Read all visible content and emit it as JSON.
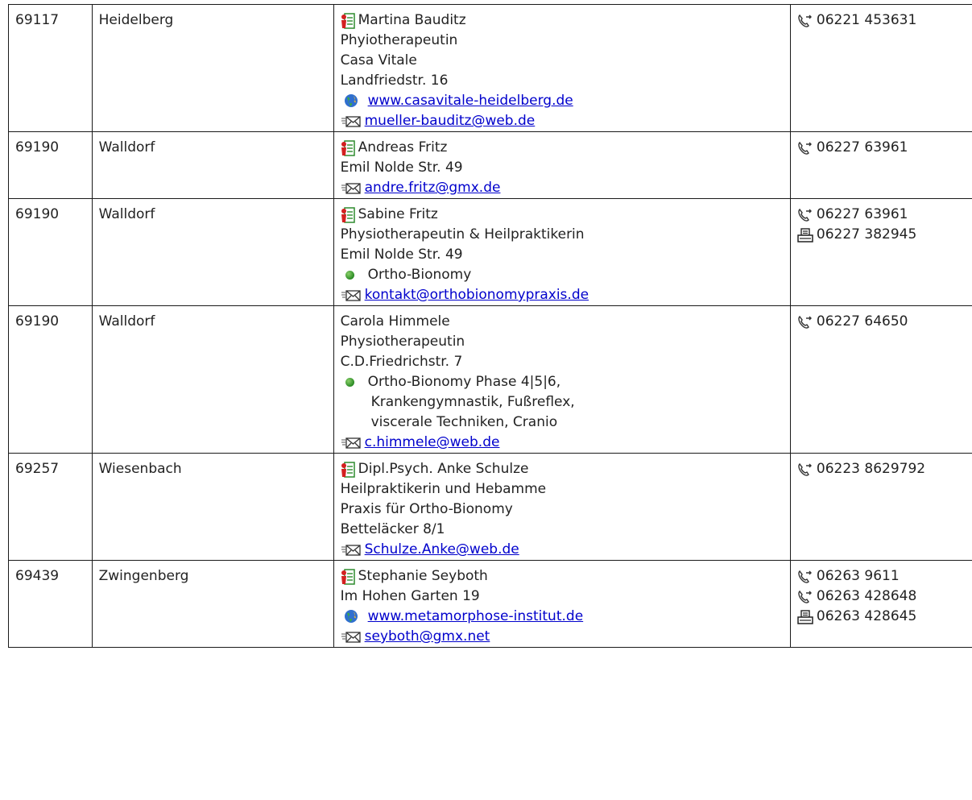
{
  "rows": [
    {
      "plz": "69117",
      "city": "Heidelberg",
      "name": "Martina Bauditz",
      "has_card": true,
      "lines": [
        "Phyiotherapeutin",
        "Casa Vitale",
        "Landfriedstr. 16"
      ],
      "web": "www.casavitale-heidelberg.de",
      "email": "mueller-bauditz@web.de",
      "phones": [
        {
          "type": "phone",
          "number": "06221 453631"
        }
      ]
    },
    {
      "plz": "69190",
      "city": "Walldorf",
      "name": "Andreas Fritz",
      "has_card": true,
      "lines": [
        "Emil Nolde Str. 49"
      ],
      "email": "andre.fritz@gmx.de",
      "phones": [
        {
          "type": "phone",
          "number": "06227 63961"
        }
      ]
    },
    {
      "plz": "69190",
      "city": "Walldorf",
      "name": "Sabine Fritz",
      "has_card": true,
      "lines": [
        "Physiotherapeutin & Heilpraktikerin",
        "Emil Nolde Str. 49"
      ],
      "bullet": [
        "Ortho-Bionomy"
      ],
      "email": "kontakt@orthobionomypraxis.de",
      "phones": [
        {
          "type": "phone",
          "number": "06227 63961"
        },
        {
          "type": "fax",
          "number": "06227 382945"
        }
      ]
    },
    {
      "plz": "69190",
      "city": "Walldorf",
      "name": "Carola Himmele",
      "has_card": false,
      "lines": [
        "Physiotherapeutin",
        "C.D.Friedrichstr. 7"
      ],
      "bullet": [
        "Ortho-Bionomy Phase 4|5|6,",
        "Krankengymnastik, Fußreflex,",
        "viscerale Techniken, Cranio"
      ],
      "email": "c.himmele@web.de",
      "phones": [
        {
          "type": "phone",
          "number": "06227 64650"
        }
      ]
    },
    {
      "plz": "69257",
      "city": "Wiesenbach",
      "name": "Dipl.Psych. Anke Schulze",
      "has_card": true,
      "lines": [
        "Heilpraktikerin und Hebamme",
        "Praxis für Ortho-Bionomy",
        "Betteläcker 8/1"
      ],
      "email": "Schulze.Anke@web.de",
      "phones": [
        {
          "type": "phone",
          "number": "06223 8629792"
        }
      ]
    },
    {
      "plz": "69439",
      "city": "Zwingenberg",
      "name": "Stephanie Seyboth",
      "has_card": true,
      "lines": [
        "Im Hohen Garten 19"
      ],
      "web": "www.metamorphose-institut.de",
      "email": "seyboth@gmx.net",
      "phones": [
        {
          "type": "phone",
          "number": "06263 9611"
        },
        {
          "type": "phone",
          "number": "06263 428648"
        },
        {
          "type": "fax",
          "number": "06263 428645"
        }
      ]
    }
  ],
  "colors": {
    "link": "#0000cc",
    "border": "#1a1a1a",
    "bullet": "#2a8a24",
    "card_red": "#d42020",
    "card_green": "#2e8b2e"
  },
  "icons": {
    "card": "vcard-icon",
    "web": "globe-icon",
    "email": "envelope-icon",
    "phone": "phone-icon",
    "fax": "fax-icon",
    "bullet": "green-dot-icon"
  }
}
